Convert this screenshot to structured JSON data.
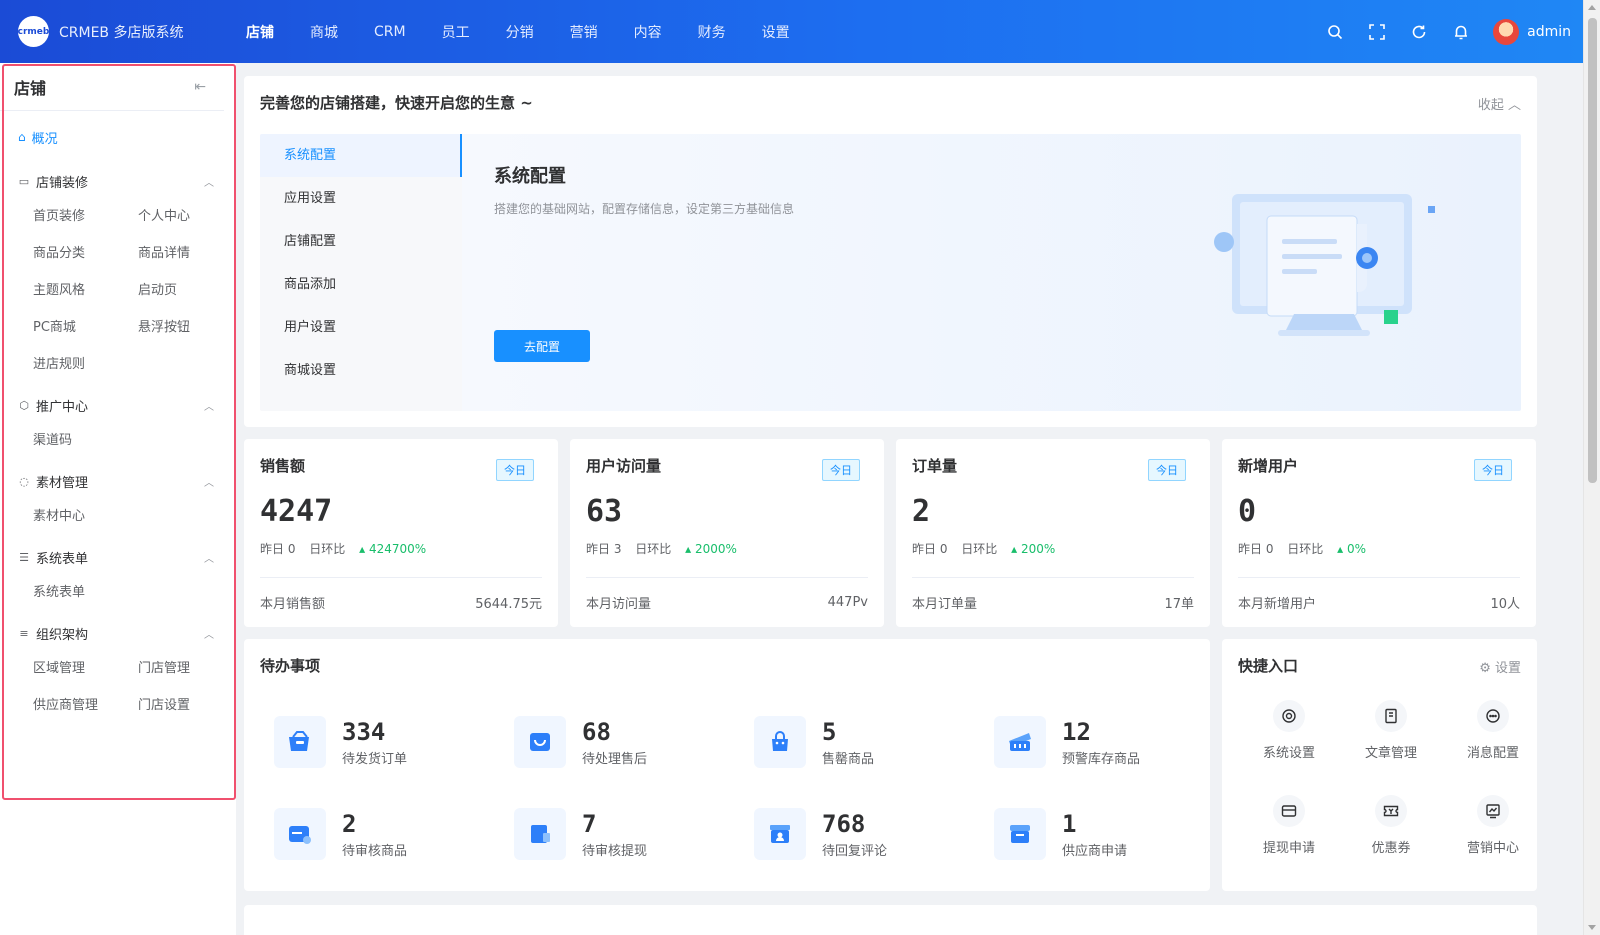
{
  "brand": {
    "logo_text": "crmeb",
    "name": "CRMEB 多店版系统"
  },
  "topnav": [
    "店铺",
    "商城",
    "CRM",
    "员工",
    "分销",
    "营销",
    "内容",
    "财务",
    "设置"
  ],
  "user": {
    "name": "admin"
  },
  "sidebar": {
    "title": "店铺",
    "overview": "概况",
    "groups": [
      {
        "label": "店铺装修",
        "items": [
          "首页装修",
          "个人中心",
          "商品分类",
          "商品详情",
          "主题风格",
          "启动页",
          "PC商城",
          "悬浮按钮",
          "进店规则"
        ]
      },
      {
        "label": "推广中心",
        "items": [
          "渠道码"
        ]
      },
      {
        "label": "素材管理",
        "items": [
          "素材中心"
        ]
      },
      {
        "label": "系统表单",
        "items": [
          "系统表单"
        ]
      },
      {
        "label": "组织架构",
        "items": [
          "区域管理",
          "门店管理",
          "供应商管理",
          "门店设置"
        ]
      }
    ]
  },
  "guide": {
    "title": "完善您的店铺搭建，快速开启您的生意 ~",
    "fold": "收起",
    "tabs": [
      "系统配置",
      "应用设置",
      "店铺配置",
      "商品添加",
      "用户设置",
      "商城设置"
    ],
    "panel": {
      "title": "系统配置",
      "desc": "搭建您的基础网站，配置存储信息，设定第三方基础信息",
      "button": "去配置"
    }
  },
  "stats": [
    {
      "title": "销售额",
      "tag": "今日",
      "value": "4247",
      "yesterday": "昨日 0",
      "ratio_label": "日环比",
      "ratio": "424700%",
      "foot_label": "本月销售额",
      "foot_value": "5644.75元"
    },
    {
      "title": "用户访问量",
      "tag": "今日",
      "value": "63",
      "yesterday": "昨日 3",
      "ratio_label": "日环比",
      "ratio": "2000%",
      "foot_label": "本月访问量",
      "foot_value": "447Pv"
    },
    {
      "title": "订单量",
      "tag": "今日",
      "value": "2",
      "yesterday": "昨日 0",
      "ratio_label": "日环比",
      "ratio": "200%",
      "foot_label": "本月订单量",
      "foot_value": "17单"
    },
    {
      "title": "新增用户",
      "tag": "今日",
      "value": "0",
      "yesterday": "昨日 0",
      "ratio_label": "日环比",
      "ratio": "0%",
      "foot_label": "本月新增用户",
      "foot_value": "10人"
    }
  ],
  "todo": {
    "title": "待办事项",
    "items": [
      {
        "num": "334",
        "label": "待发货订单",
        "icon": "box-truck-icon"
      },
      {
        "num": "68",
        "label": "待处理售后",
        "icon": "cart-return-icon"
      },
      {
        "num": "5",
        "label": "售罄商品",
        "icon": "bag-icon"
      },
      {
        "num": "12",
        "label": "预警库存商品",
        "icon": "stock-warning-icon"
      },
      {
        "num": "2",
        "label": "待审核商品",
        "icon": "goods-review-icon"
      },
      {
        "num": "7",
        "label": "待审核提现",
        "icon": "withdraw-review-icon"
      },
      {
        "num": "768",
        "label": "待回复评论",
        "icon": "comment-reply-icon"
      },
      {
        "num": "1",
        "label": "供应商申请",
        "icon": "supplier-icon"
      }
    ]
  },
  "quick": {
    "title": "快捷入口",
    "setting": "设置",
    "items": [
      {
        "label": "系统设置",
        "icon": "gear-icon"
      },
      {
        "label": "文章管理",
        "icon": "article-icon"
      },
      {
        "label": "消息配置",
        "icon": "message-icon"
      },
      {
        "label": "提现申请",
        "icon": "card-icon"
      },
      {
        "label": "优惠券",
        "icon": "coupon-icon"
      },
      {
        "label": "营销中心",
        "icon": "marketing-icon"
      }
    ]
  },
  "colors": {
    "primary": "#1890ff",
    "topbar": "#1d6ef0",
    "up": "#19be6b",
    "highlight_frame": "#f0506e"
  }
}
